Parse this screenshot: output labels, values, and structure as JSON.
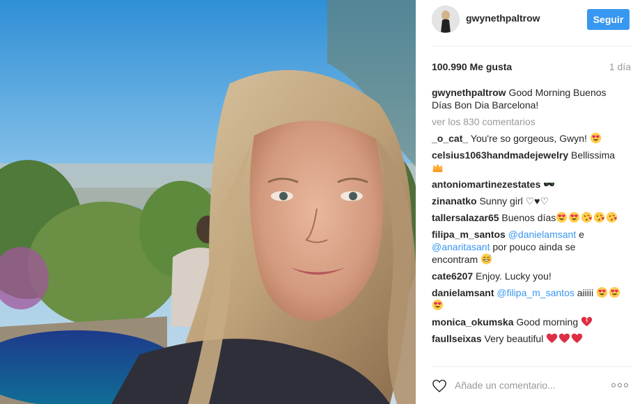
{
  "post": {
    "username": "gwynethpaltrow",
    "follow_label": "Seguir",
    "likes": "100.990 Me gusta",
    "time_ago": "1 día"
  },
  "caption": {
    "username": "gwynethpaltrow",
    "text": " Good Morning Buenos Días Bon Dia Barcelona!"
  },
  "view_all_comments": "ver los 830 comentarios",
  "comments": [
    {
      "user": "_o_cat_",
      "pre": " You're so gorgeous, Gwyn! ",
      "emojis": [
        "heart-eyes"
      ]
    },
    {
      "user": "celsius1063handmadejewelry",
      "pre": " Bellissima ",
      "emojis": [
        "crown"
      ]
    },
    {
      "user": "antoniomartinezestates",
      "pre": " ",
      "emojis": [
        "sunglasses"
      ]
    },
    {
      "user": "zinanatko",
      "pre": " Sunny girl ♡♥♡",
      "emojis": []
    },
    {
      "user": "tallersalazar65",
      "pre": " Buenos días",
      "emojis": [
        "heart-eyes",
        "heart-eyes",
        "kiss-face",
        "kiss-face",
        "kiss-face"
      ]
    },
    {
      "user": "filipa_m_santos",
      "pre": " ",
      "mention1": "@danielamsant",
      "mid": " e ",
      "mention2": "@anaritasant",
      "post": " por pouco ainda se encontram ",
      "emojis": [
        "grin-sweat"
      ]
    },
    {
      "user": "cate6207",
      "pre": " Enjoy. Lucky you!",
      "emojis": []
    },
    {
      "user": "danielamsant",
      "pre": " ",
      "mention1": "@filipa_m_santos",
      "post": " aiiiii ",
      "emojis": [
        "heart-eyes",
        "heart-eyes",
        "heart-eyes"
      ]
    },
    {
      "user": "monica_okumska",
      "pre": " Good morning ",
      "emojis": [
        "broken-heart"
      ]
    },
    {
      "user": "faullseixas",
      "pre": " Very beautiful ",
      "emojis": [
        "heart",
        "heart",
        "heart"
      ]
    }
  ],
  "add_comment_placeholder": "Añade un comentario...",
  "colors": {
    "accent": "#3897f0",
    "text": "#262626",
    "muted": "#999999"
  }
}
